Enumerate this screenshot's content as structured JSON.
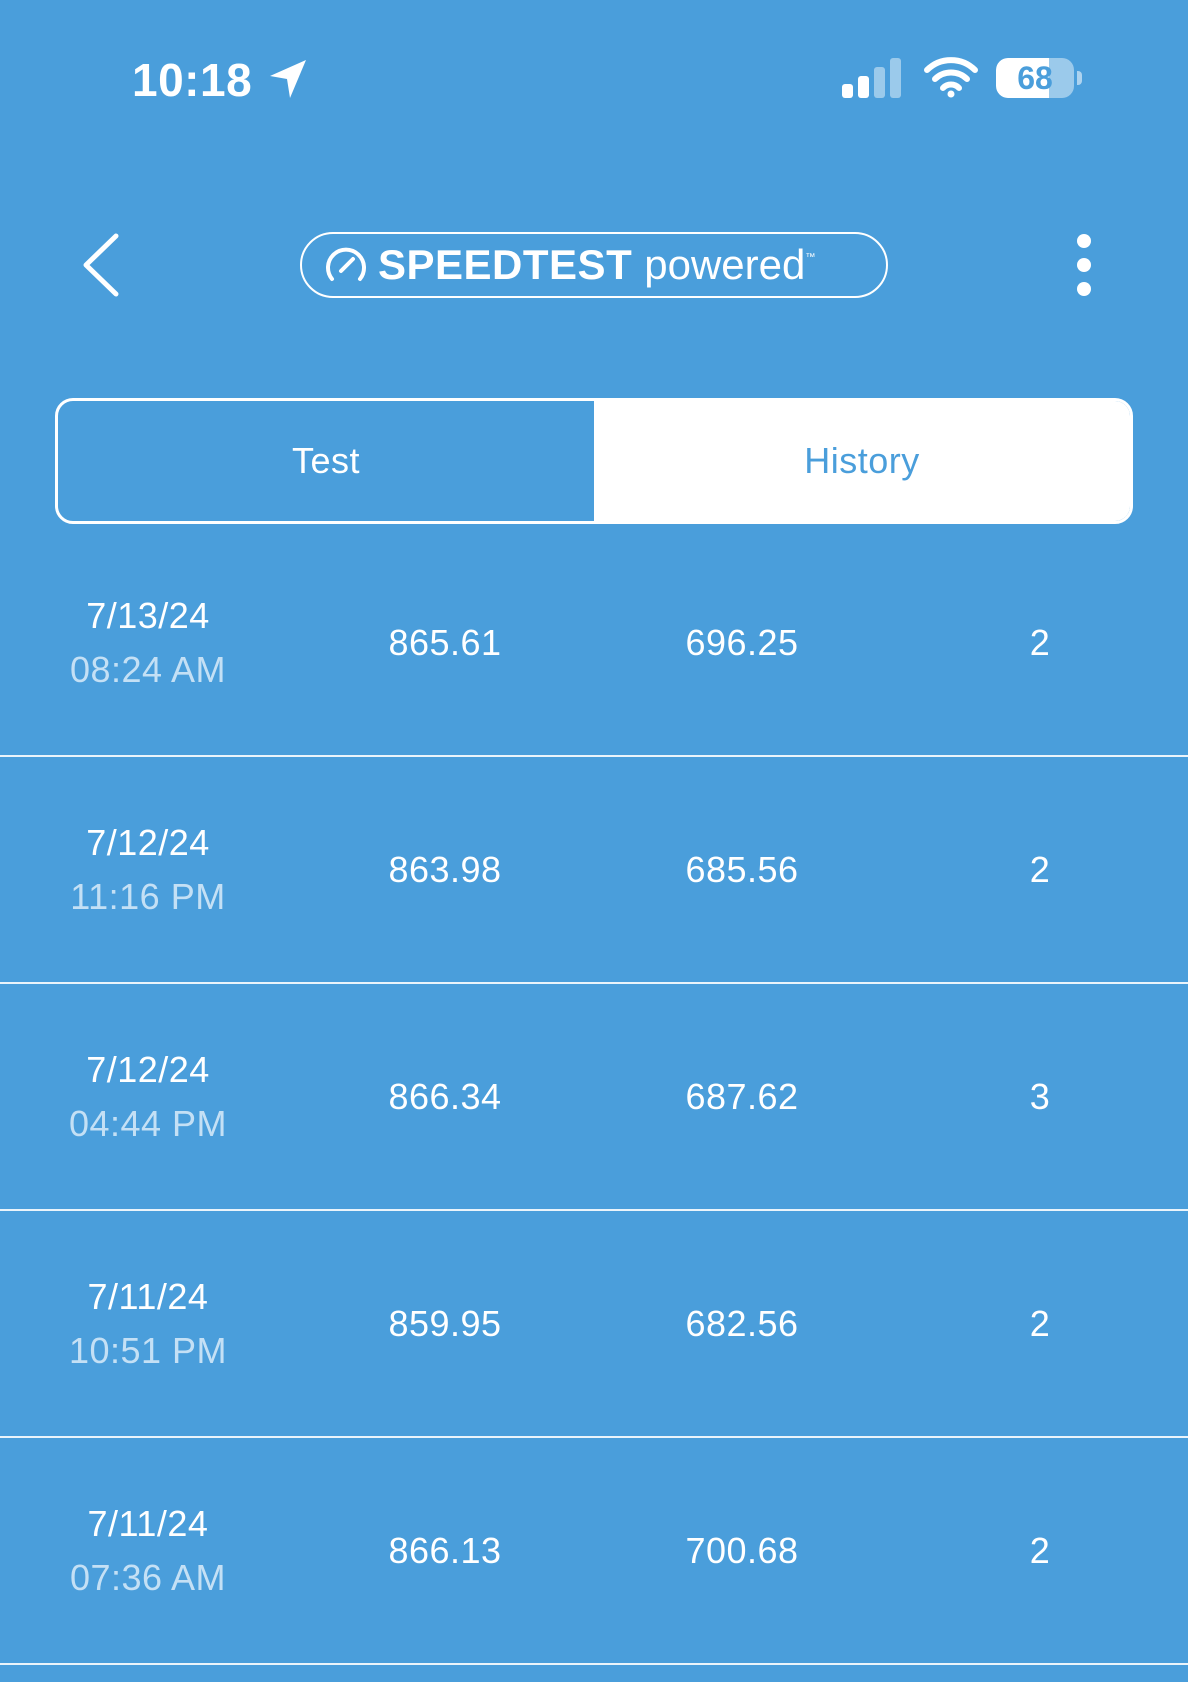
{
  "status_bar": {
    "time": "10:18",
    "battery_level": 68,
    "battery_text": "68",
    "icons": [
      "location-arrow-icon",
      "cellular-signal-icon",
      "wifi-icon",
      "battery-icon"
    ]
  },
  "header": {
    "back_icon": "chevron-left-icon",
    "brand_icon": "speedometer-icon",
    "brand_name": "SPEEDTEST",
    "brand_suffix": "powered",
    "brand_mark": "™",
    "more_icon": "vertical-ellipsis-icon"
  },
  "tabs": [
    {
      "label": "Test",
      "active": false
    },
    {
      "label": "History",
      "active": true
    }
  ],
  "history": [
    {
      "date": "7/13/24",
      "time": "08:24 AM",
      "download": "865.61",
      "upload": "696.25",
      "ping": "2"
    },
    {
      "date": "7/12/24",
      "time": "11:16 PM",
      "download": "863.98",
      "upload": "685.56",
      "ping": "2"
    },
    {
      "date": "7/12/24",
      "time": "04:44 PM",
      "download": "866.34",
      "upload": "687.62",
      "ping": "3"
    },
    {
      "date": "7/11/24",
      "time": "10:51 PM",
      "download": "859.95",
      "upload": "682.56",
      "ping": "2"
    },
    {
      "date": "7/11/24",
      "time": "07:36 AM",
      "download": "866.13",
      "upload": "700.68",
      "ping": "2"
    }
  ],
  "colors": {
    "background": "#4a9edb",
    "foreground": "#ffffff",
    "time_muted": "#c4e0f5",
    "divider": "#eaf4fb"
  }
}
